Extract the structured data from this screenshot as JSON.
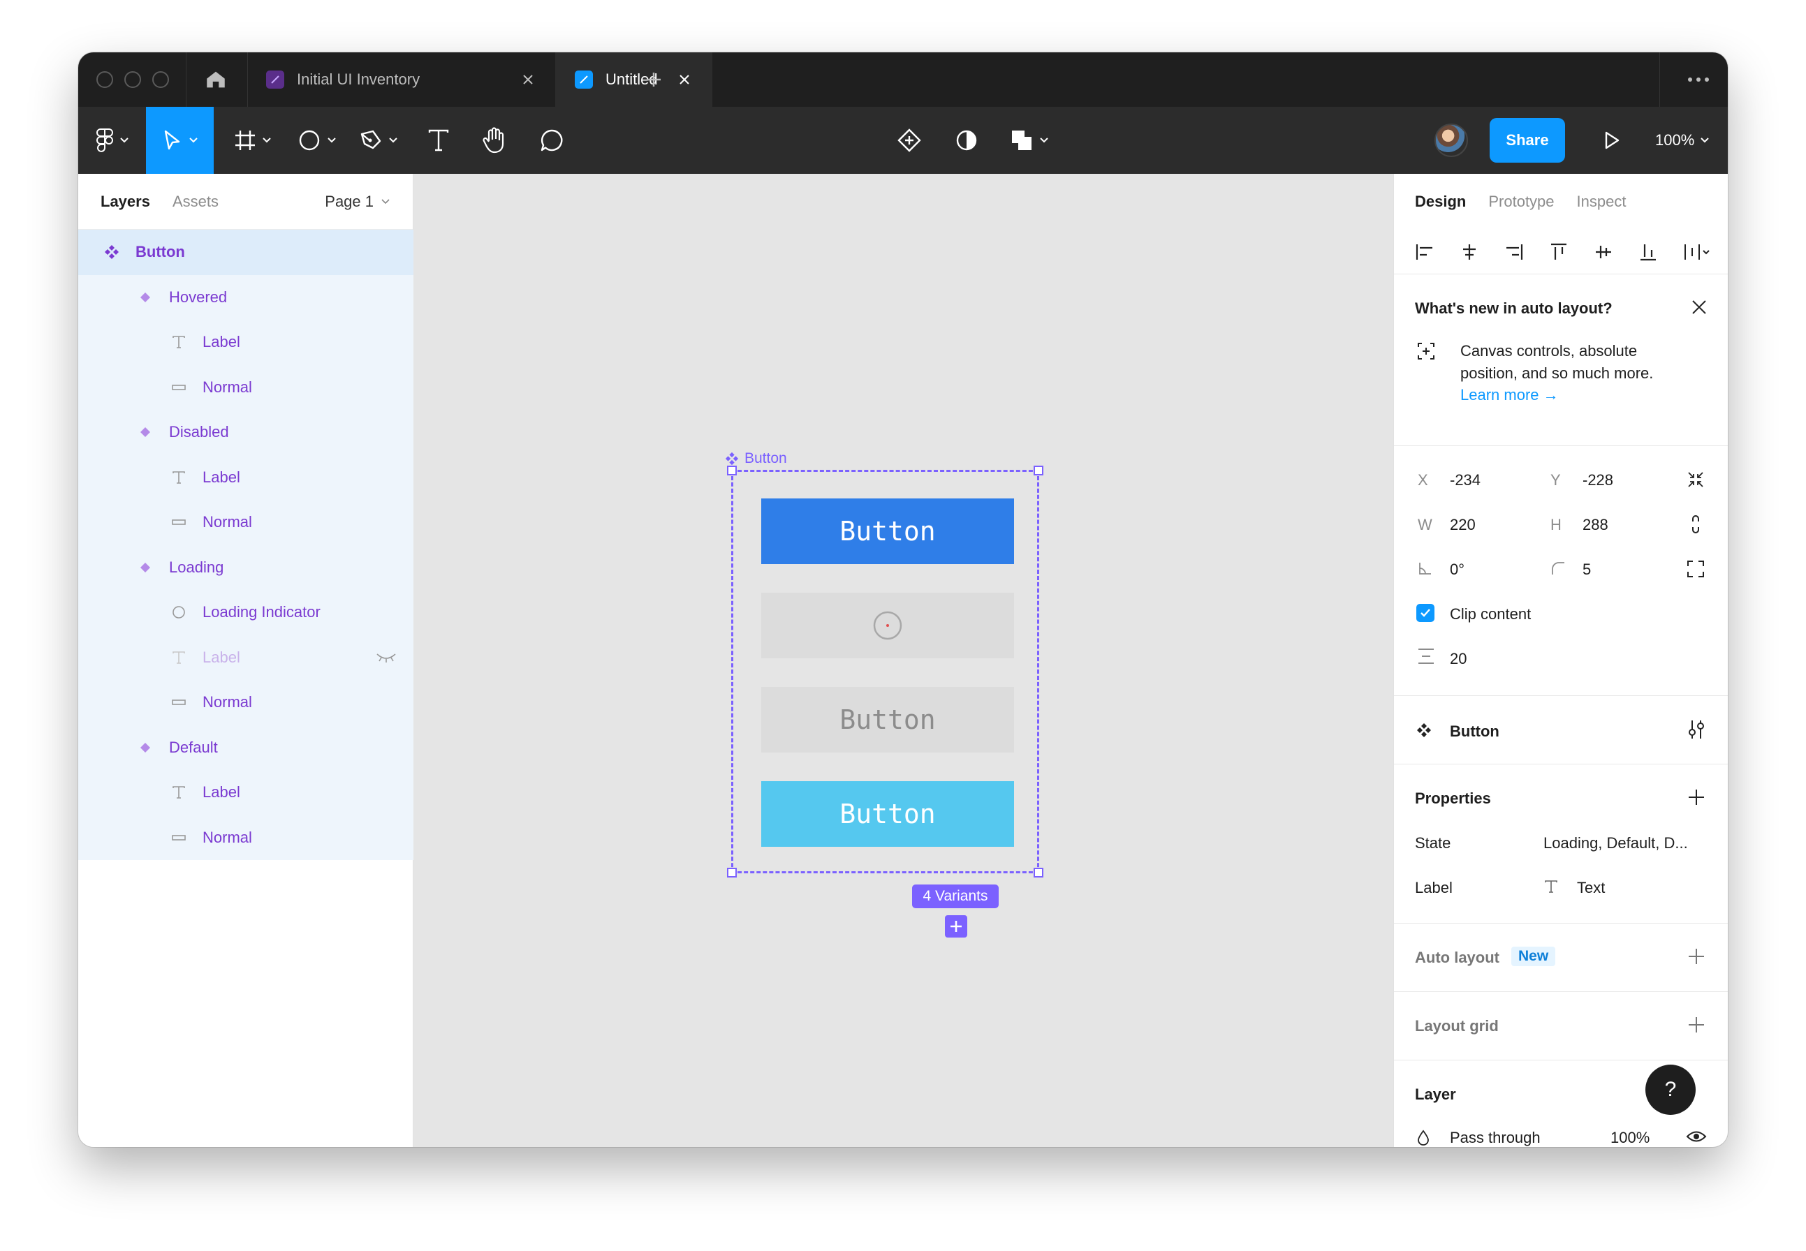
{
  "tabs": {
    "tab1_label": "Initial UI Inventory",
    "tab2_label": "Untitled"
  },
  "toolbar": {
    "share_label": "Share",
    "zoom_label": "100%"
  },
  "left_panel": {
    "layers_tab": "Layers",
    "assets_tab": "Assets",
    "page_label": "Page 1",
    "layers": [
      {
        "label": "Button",
        "icon": "component-set-icon"
      },
      {
        "label": "Hovered",
        "icon": "variant-icon"
      },
      {
        "label": "Label",
        "icon": "text-icon"
      },
      {
        "label": "Normal",
        "icon": "rectangle-icon"
      },
      {
        "label": "Disabled",
        "icon": "variant-icon"
      },
      {
        "label": "Label",
        "icon": "text-icon"
      },
      {
        "label": "Normal",
        "icon": "rectangle-icon"
      },
      {
        "label": "Loading",
        "icon": "variant-icon"
      },
      {
        "label": "Loading Indicator",
        "icon": "ellipse-icon"
      },
      {
        "label": "Label",
        "icon": "text-icon",
        "hidden": true
      },
      {
        "label": "Normal",
        "icon": "rectangle-icon"
      },
      {
        "label": "Default",
        "icon": "variant-icon"
      },
      {
        "label": "Label",
        "icon": "text-icon"
      },
      {
        "label": "Normal",
        "icon": "rectangle-icon"
      }
    ]
  },
  "canvas": {
    "frame_label": "Button",
    "buttons": [
      {
        "label": "Button",
        "bg": "#2f7ee8",
        "color": "#ffffff"
      },
      {
        "label": "",
        "bg": "#dcdcdc",
        "color": "#8c8c8c"
      },
      {
        "label": "Button",
        "bg": "#dcdcdc",
        "color": "#8c8c8c"
      },
      {
        "label": "Button",
        "bg": "#55c8ef",
        "color": "#ffffff"
      }
    ],
    "variants_badge": "4 Variants"
  },
  "right_panel": {
    "design_tab": "Design",
    "prototype_tab": "Prototype",
    "inspect_tab": "Inspect",
    "whats_new": {
      "title": "What's new in auto layout?",
      "body": "Canvas controls, absolute position, and so much more.",
      "link": "Learn more →"
    },
    "geometry": {
      "x_label": "X",
      "x": "-234",
      "y_label": "Y",
      "y": "-228",
      "w_label": "W",
      "w": "220",
      "h_label": "H",
      "h": "288",
      "rotation": "0°",
      "radius": "5",
      "clip_label": "Clip content",
      "spacing": "20"
    },
    "component_name": "Button",
    "properties": {
      "title": "Properties",
      "state_label": "State",
      "state_value": "Loading, Default, D...",
      "label_label": "Label",
      "label_value": "Text"
    },
    "auto_layout": {
      "title": "Auto layout",
      "badge": "New"
    },
    "layout_grid": "Layout grid",
    "layer": {
      "title": "Layer",
      "blend": "Pass through",
      "opacity": "100%"
    },
    "help": "?"
  },
  "colors": {
    "accent": "#0d99ff",
    "component": "#7b61ff",
    "layer_text": "#7b3ad1"
  }
}
